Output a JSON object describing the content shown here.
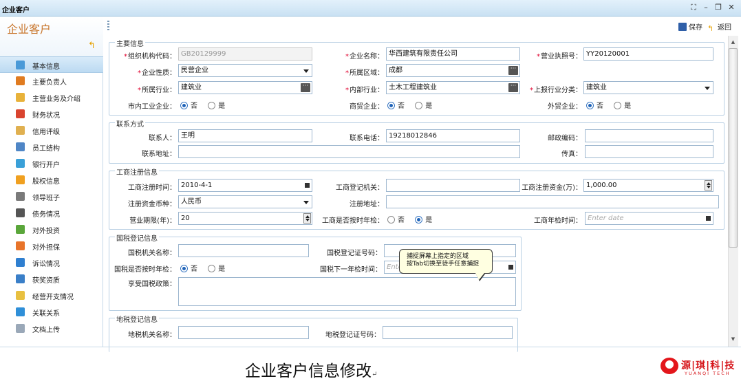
{
  "window": {
    "title": "企业客户",
    "controls": [
      "⛶",
      "–",
      "❐",
      "✕"
    ]
  },
  "sidebar": {
    "title": "企业客户",
    "items": [
      {
        "label": "基本信息",
        "icon": "document-icon",
        "color": "#4a9ad8",
        "active": true
      },
      {
        "label": "主要负责人",
        "icon": "person-icon",
        "color": "#e07b20"
      },
      {
        "label": "主营业务及介绍",
        "icon": "star-icon",
        "color": "#e8b23a"
      },
      {
        "label": "财务状况",
        "icon": "chart-icon",
        "color": "#d9442f"
      },
      {
        "label": "信用评级",
        "icon": "clipboard-icon",
        "color": "#e0b050"
      },
      {
        "label": "员工结构",
        "icon": "people-icon",
        "color": "#4f86c6"
      },
      {
        "label": "银行开户",
        "icon": "bank-icon",
        "color": "#3aa0d8"
      },
      {
        "label": "股权信息",
        "icon": "pie-icon",
        "color": "#f0a020"
      },
      {
        "label": "领导班子",
        "icon": "leader-icon",
        "color": "#7a7a7a"
      },
      {
        "label": "债务情况",
        "icon": "debt-icon",
        "color": "#555555"
      },
      {
        "label": "对外投资",
        "icon": "invest-icon",
        "color": "#5aa63a"
      },
      {
        "label": "对外担保",
        "icon": "guarantee-icon",
        "color": "#e8742a"
      },
      {
        "label": "诉讼情况",
        "icon": "lawsuit-icon",
        "color": "#2f7fd0"
      },
      {
        "label": "获奖资质",
        "icon": "award-icon",
        "color": "#3a7fc8"
      },
      {
        "label": "经营开支情况",
        "icon": "expense-icon",
        "color": "#e8c040"
      },
      {
        "label": "关联关系",
        "icon": "relation-icon",
        "color": "#2f8fd8"
      },
      {
        "label": "文档上传",
        "icon": "upload-icon",
        "color": "#9aa8b8"
      }
    ]
  },
  "toolbar": {
    "save_label": "保存",
    "back_label": "返回"
  },
  "sections": {
    "main_info": {
      "legend": "主要信息",
      "org_code_label": "组织机构代码：",
      "org_code_value": "GB20129999",
      "company_name_label": "企业名称：",
      "company_name_value": "华西建筑有限责任公司",
      "license_label": "营业执照号：",
      "license_value": "YY20120001",
      "nature_label": "企业性质：",
      "nature_value": "民营企业",
      "region_label": "所属区域：",
      "region_value": "成都",
      "industry_label": "所属行业：",
      "industry_value": "建筑业",
      "inner_industry_label": "内部行业：",
      "inner_industry_value": "土木工程建筑业",
      "report_category_label": "上报行业分类：",
      "report_category_value": "建筑业",
      "city_enterprise_label": "市内工业企业：",
      "commerce_label": "商贸企业：",
      "foreign_trade_label": "外贸企业：",
      "no": "否",
      "yes": "是"
    },
    "contact": {
      "legend": "联系方式",
      "contact_label": "联系人：",
      "contact_value": "王明",
      "phone_label": "联系电话：",
      "phone_value": "19218012846",
      "postcode_label": "邮政编码：",
      "address_label": "联系地址：",
      "fax_label": "传真："
    },
    "registration": {
      "legend": "工商注册信息",
      "reg_time_label": "工商注册时间：",
      "reg_time_value": "2010-4-1",
      "reg_authority_label": "工商登记机关：",
      "reg_capital_label": "工商注册资金(万)：",
      "reg_capital_value": "1,000.00",
      "currency_label": "注册资金币种：",
      "currency_value": "人民币",
      "reg_address_label": "注册地址：",
      "term_label": "营业期限(年)：",
      "term_value": "20",
      "annual_check_label": "工商是否按时年检：",
      "annual_check_time_label": "工商年检时间：",
      "date_placeholder": "Enter date"
    },
    "national_tax": {
      "legend": "国税登记信息",
      "authority_label": "国税机关名称：",
      "cert_label": "国税登记证号码：",
      "annual_check_label": "国税是否按时年检：",
      "next_check_label": "国税下一年检时间：",
      "date_placeholder": "Ente",
      "policy_label": "享受国税政策："
    },
    "local_tax": {
      "legend": "地税登记信息",
      "authority_label": "地税机关名称：",
      "cert_label": "地税登记证号码："
    }
  },
  "tooltip": {
    "line1": "捕捉屏幕上指定的区域",
    "line2": "按Tab切换至徒手任意捕捉"
  },
  "caption": {
    "text": "企业客户信息修改",
    "mark": "↵"
  },
  "logo": {
    "cn": "源|琪|科|技",
    "en": "YUANQI TECH",
    "color": "#d6161b"
  }
}
